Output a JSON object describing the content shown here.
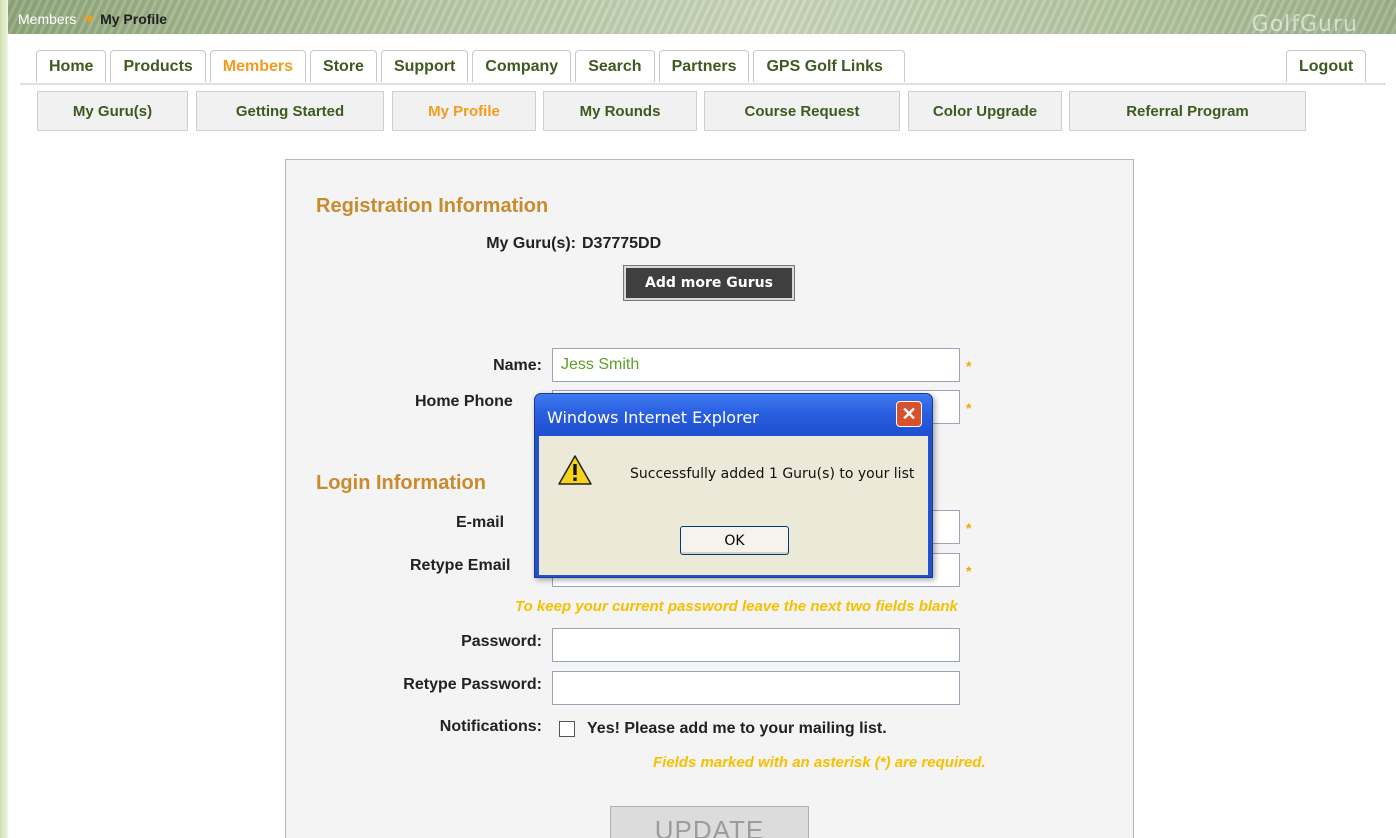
{
  "breadcrumb": {
    "parent": "Members",
    "current": "My Profile"
  },
  "brand": "GolfGuru",
  "main_tabs": [
    {
      "label": "Home",
      "active": false
    },
    {
      "label": "Products",
      "active": false
    },
    {
      "label": "Members",
      "active": true
    },
    {
      "label": "Store",
      "active": false
    },
    {
      "label": "Support",
      "active": false
    },
    {
      "label": "Company",
      "active": false
    },
    {
      "label": "Search",
      "active": false
    },
    {
      "label": "Partners",
      "active": false
    },
    {
      "label": "GPS Golf Links",
      "active": false
    }
  ],
  "logout": "Logout",
  "sub_tabs": [
    {
      "label": "My Guru(s)",
      "active": false
    },
    {
      "label": "Getting Started",
      "active": false
    },
    {
      "label": "My Profile",
      "active": true
    },
    {
      "label": "My Rounds",
      "active": false
    },
    {
      "label": "Course Request",
      "active": false
    },
    {
      "label": "Color Upgrade",
      "active": false
    },
    {
      "label": "Referral Program",
      "active": false
    }
  ],
  "form": {
    "registration_title": "Registration Information",
    "gurus_label": "My Guru(s):",
    "gurus_value": "D37775DD",
    "add_gurus_button": "Add more Gurus",
    "name_label": "Name:",
    "name_value": "Jess Smith",
    "home_phone_label": "Home Phone",
    "login_title": "Login Information",
    "email_label": "E-mail",
    "retype_email_label": "Retype Email",
    "password_note": "To keep your current password leave the next two fields blank",
    "password_label": "Password:",
    "retype_password_label": "Retype Password:",
    "notifications_label": "Notifications:",
    "notifications_text": "Yes! Please add me to your mailing list.",
    "required_note": "Fields marked with an asterisk (*) are required.",
    "asterisk": "*",
    "update_button": "UPDATE"
  },
  "dialog": {
    "title": "Windows Internet Explorer",
    "message": "Successfully added 1 Guru(s) to your list",
    "ok_button": "OK",
    "icon": "warning-icon"
  },
  "colors": {
    "accent_orange": "#f39b1d",
    "nav_green": "#3d5a1f",
    "section_title": "#c88b2e",
    "note_yellow": "#f6c000",
    "dialog_blue": "#2153c8"
  }
}
